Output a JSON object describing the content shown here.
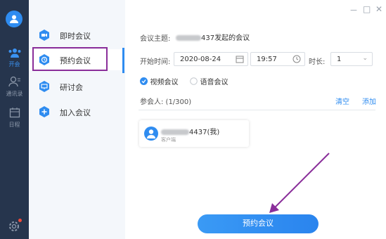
{
  "rail": {
    "items": [
      {
        "label": "开会"
      },
      {
        "label": "通讯录"
      },
      {
        "label": "日程"
      }
    ]
  },
  "meeting_types": [
    {
      "label": "即时会议"
    },
    {
      "label": "预约会议"
    },
    {
      "label": "研讨会"
    },
    {
      "label": "加入会议"
    }
  ],
  "window_controls": {
    "minimize": "－",
    "maximize": "□",
    "close": "✕"
  },
  "form": {
    "subject_label": "会议主题:",
    "subject_value": "437发起的会议",
    "start_label": "开始时间:",
    "date_value": "2020-08-24",
    "time_value": "19:57",
    "duration_label": "时长:",
    "duration_value": "1",
    "video_option": "视频会议",
    "voice_option": "语音会议",
    "participants_label": "参会人: (1/300)",
    "clear_label": "清空",
    "add_label": "添加"
  },
  "participant": {
    "name_suffix": "4437(我)",
    "role": "客户端"
  },
  "submit_label": "预约会议",
  "colors": {
    "accent": "#2f8cf0",
    "rail_bg": "#26354d",
    "highlight": "#8a2e9a"
  }
}
